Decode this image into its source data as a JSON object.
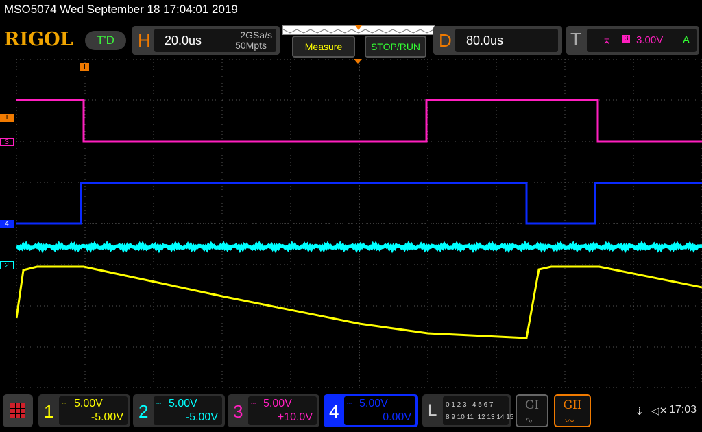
{
  "header": {
    "title": "MSO5074  Wed September 18 17:04:01 2019",
    "logo": "RIGOL",
    "td_label": "T'D"
  },
  "horizontal": {
    "label": "H",
    "timebase": "20.0us",
    "sample_rate": "2GSa/s",
    "memory_depth": "50Mpts"
  },
  "buttons": {
    "measure": "Measure",
    "stop_run": "STOP/RUN"
  },
  "delay": {
    "label": "D",
    "value": "80.0us"
  },
  "trigger": {
    "label": "T",
    "edge_symbol": "⌆",
    "source_symbol": "3",
    "level": "3.00V",
    "mode": "A"
  },
  "markers": {
    "trigger_level": "T",
    "ch3": "3",
    "ch4": "4",
    "ch2": "2",
    "trigger_pos": "T"
  },
  "channels": [
    {
      "num": "1",
      "scale": "5.00V",
      "offset": "-5.00V",
      "color": "#ffff00"
    },
    {
      "num": "2",
      "scale": "5.00V",
      "offset": "-5.00V",
      "color": "#00ffff"
    },
    {
      "num": "3",
      "scale": "5.00V",
      "offset": "+10.0V",
      "color": "#ff1fbf"
    },
    {
      "num": "4",
      "scale": "5.00V",
      "offset": "0.00V",
      "color": "#0a2aff"
    }
  ],
  "logic": {
    "label": "L",
    "row1": "0 1 2 3   4 5 6 7",
    "row2": "8 9 10 11  12 13 14 15"
  },
  "gen1": {
    "label": "GI"
  },
  "gen2": {
    "label": "GII"
  },
  "status": {
    "time": "17:03"
  }
}
